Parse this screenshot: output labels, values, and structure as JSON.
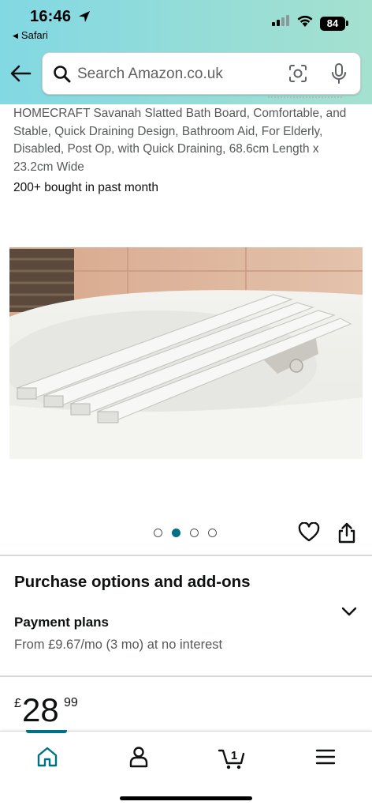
{
  "status_bar": {
    "time": "16:46",
    "back_app": "Safari",
    "battery": "84"
  },
  "search": {
    "placeholder": "Search Amazon.co.uk"
  },
  "product": {
    "title": "HOMECRAFT Savanah Slatted Bath Board, Comfortable, and Stable, Quick Draining Design, Bathroom Aid, For Elderly, Disabled, Post Op, with Quick Draining, 68.6cm Length x 23.2cm Wide",
    "bought": "200+ bought in past month"
  },
  "carousel": {
    "total": 4,
    "active_index": 1
  },
  "purchase": {
    "section_title": "Purchase options and add-ons",
    "payment_title": "Payment plans",
    "payment_desc": "From £9.67/mo (3 mo) at no interest"
  },
  "price": {
    "currency": "£",
    "whole": "28",
    "fraction": "99"
  },
  "nav": {
    "cart_count": "1",
    "items": [
      "home-icon",
      "account-icon",
      "cart-icon",
      "menu-icon"
    ]
  },
  "colors": {
    "accent": "#007185",
    "header_gradient_start": "#82d8e3",
    "header_gradient_end": "#a5e1cf"
  }
}
